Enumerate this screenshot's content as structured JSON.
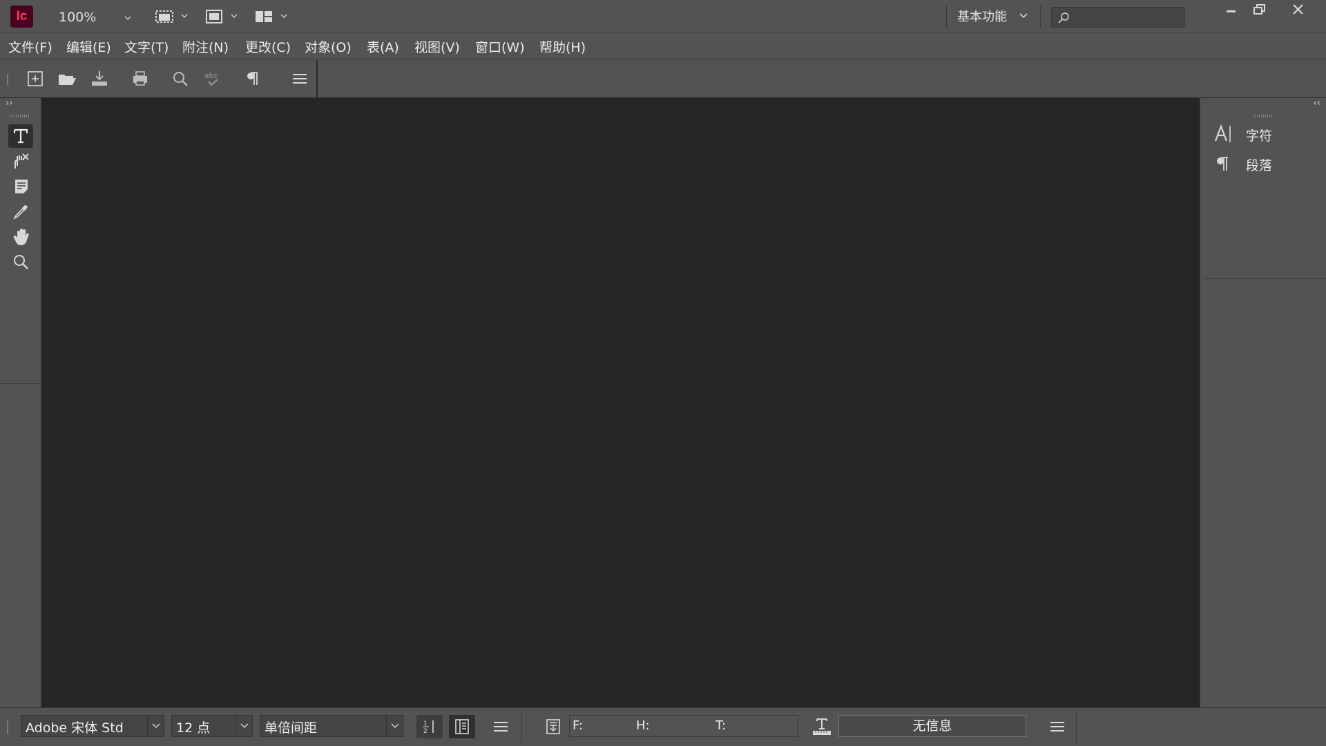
{
  "app": {
    "logo_text": "Ic",
    "brand_color": "#ff3366",
    "zoom": "100%",
    "workspace_label": "基本功能",
    "search_placeholder": ""
  },
  "menu": [
    "文件(F)",
    "编辑(E)",
    "文字(T)",
    "附注(N)",
    "更改(C)",
    "对象(O)",
    "表(A)",
    "视图(V)",
    "窗口(W)",
    "帮助(H)"
  ],
  "toolbar_icons": [
    "new-document-icon",
    "open-folder-icon",
    "save-icon",
    "print-icon",
    "find-icon",
    "spell-check-icon",
    "pilcrow-icon",
    "menu-lines-icon"
  ],
  "tools_icons": [
    "type-tool-icon",
    "note-tool-icon",
    "notes-list-icon",
    "eyedropper-icon",
    "hand-icon",
    "zoom-icon"
  ],
  "right_panel": {
    "items": [
      {
        "icon": "character-icon",
        "label": "字符"
      },
      {
        "icon": "paragraph-icon",
        "label": "段落"
      }
    ]
  },
  "status": {
    "font": "Adobe 宋体 Std",
    "size": "12 点",
    "spacing": "单倍间距",
    "f_label": "F:",
    "h_label": "H:",
    "t_label": "T:",
    "info": "无信息"
  }
}
